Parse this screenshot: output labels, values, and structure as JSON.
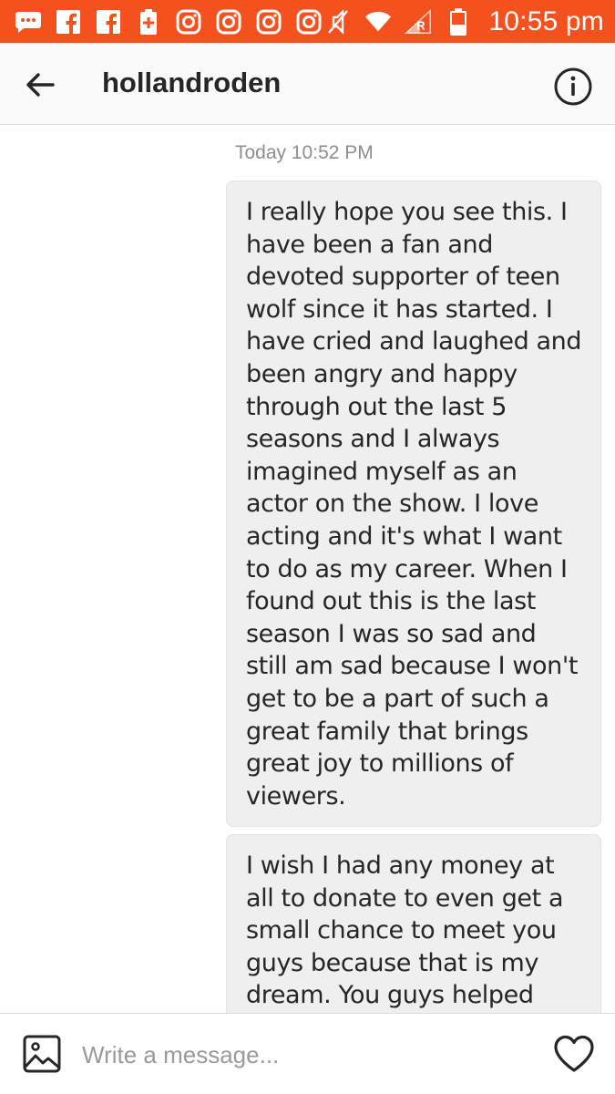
{
  "status_bar": {
    "time": "10:55 pm",
    "icons": [
      "messages-icon",
      "facebook-icon",
      "facebook-icon",
      "battery-saver-icon",
      "instagram-icon",
      "instagram-icon",
      "instagram-icon",
      "instagram-icon",
      "mute-icon",
      "wifi-icon",
      "signal-icon",
      "battery-icon"
    ],
    "background_color": "#f4511e"
  },
  "header": {
    "title": "hollandroden",
    "back_icon": "arrow-left-icon",
    "info_icon": "info-icon"
  },
  "thread": {
    "timestamp": "Today 10:52 PM",
    "messages": [
      {
        "text": "I really hope you see this. I have been a fan and devoted supporter of teen wolf since it has started. I have cried and laughed and been angry and happy through out the last 5 seasons and I always imagined myself as an actor on the show. I love acting and it's what I want to do as my career. When I found out this is the last season I was so sad and still am sad because I won't get to be a part of such a great family that brings great joy to millions of viewers."
      },
      {
        "text": "I wish I had any money at all to donate to even get a small chance to meet you guys because that is my dream. You guys helped"
      }
    ]
  },
  "composer": {
    "placeholder": "Write a message...",
    "value": "",
    "gallery_icon": "image-icon",
    "like_icon": "heart-icon"
  }
}
